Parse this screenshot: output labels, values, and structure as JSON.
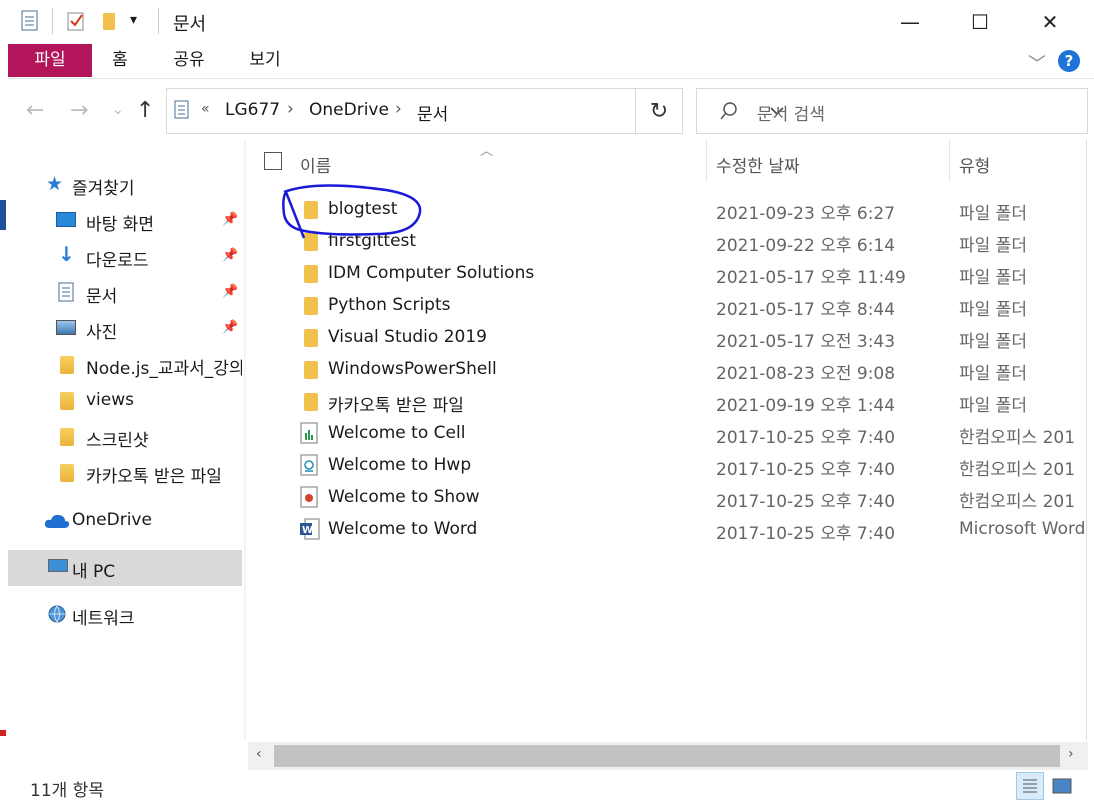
{
  "window": {
    "title": "문서",
    "minimize": "—",
    "maximize": "☐",
    "close": "✕"
  },
  "ribbon": {
    "tabs": [
      "파일",
      "홈",
      "공유",
      "보기"
    ],
    "expand": "﹀",
    "help": "?"
  },
  "address": {
    "overflow": "«",
    "crumbs": [
      "LG677",
      "OneDrive",
      "문서"
    ],
    "sep": "›"
  },
  "search": {
    "placeholder": "문서 검색"
  },
  "sidebar": {
    "quick_access": "즐겨찾기",
    "pinned": [
      "바탕 화면",
      "다운로드",
      "문서",
      "사진"
    ],
    "folders": [
      "Node.js_교과서_강의",
      "views",
      "스크린샷",
      "카카오톡 받은 파일"
    ],
    "onedrive": "OneDrive",
    "this_pc": "내 PC",
    "network": "네트워크"
  },
  "columns": {
    "name": "이름",
    "date": "수정한 날짜",
    "type": "유형"
  },
  "files": [
    {
      "name": "blogtest",
      "date": "2021-09-23 오후 6:27",
      "type": "파일 폴더",
      "icon": "folder"
    },
    {
      "name": "firstgittest",
      "date": "2021-09-22 오후 6:14",
      "type": "파일 폴더",
      "icon": "folder"
    },
    {
      "name": "IDM Computer Solutions",
      "date": "2021-05-17 오후 11:49",
      "type": "파일 폴더",
      "icon": "folder"
    },
    {
      "name": "Python Scripts",
      "date": "2021-05-17 오후 8:44",
      "type": "파일 폴더",
      "icon": "folder"
    },
    {
      "name": "Visual Studio 2019",
      "date": "2021-05-17 오전 3:43",
      "type": "파일 폴더",
      "icon": "folder"
    },
    {
      "name": "WindowsPowerShell",
      "date": "2021-08-23 오전 9:08",
      "type": "파일 폴더",
      "icon": "folder"
    },
    {
      "name": "카카오톡 받은 파일",
      "date": "2021-09-19 오후 1:44",
      "type": "파일 폴더",
      "icon": "folder"
    },
    {
      "name": "Welcome to Cell",
      "date": "2017-10-25 오후 7:40",
      "type": "한컴오피스 201",
      "icon": "cell"
    },
    {
      "name": "Welcome to Hwp",
      "date": "2017-10-25 오후 7:40",
      "type": "한컴오피스 201",
      "icon": "hwp"
    },
    {
      "name": "Welcome to Show",
      "date": "2017-10-25 오후 7:40",
      "type": "한컴오피스 201",
      "icon": "show"
    },
    {
      "name": "Welcome to Word",
      "date": "2017-10-25 오후 7:40",
      "type": "Microsoft Word",
      "icon": "word"
    }
  ],
  "status": {
    "count": "11개 항목"
  },
  "colors": {
    "file_tab": "#b21559",
    "annotation": "#1a1ad8",
    "selected_nav": "#d9d9d9"
  }
}
